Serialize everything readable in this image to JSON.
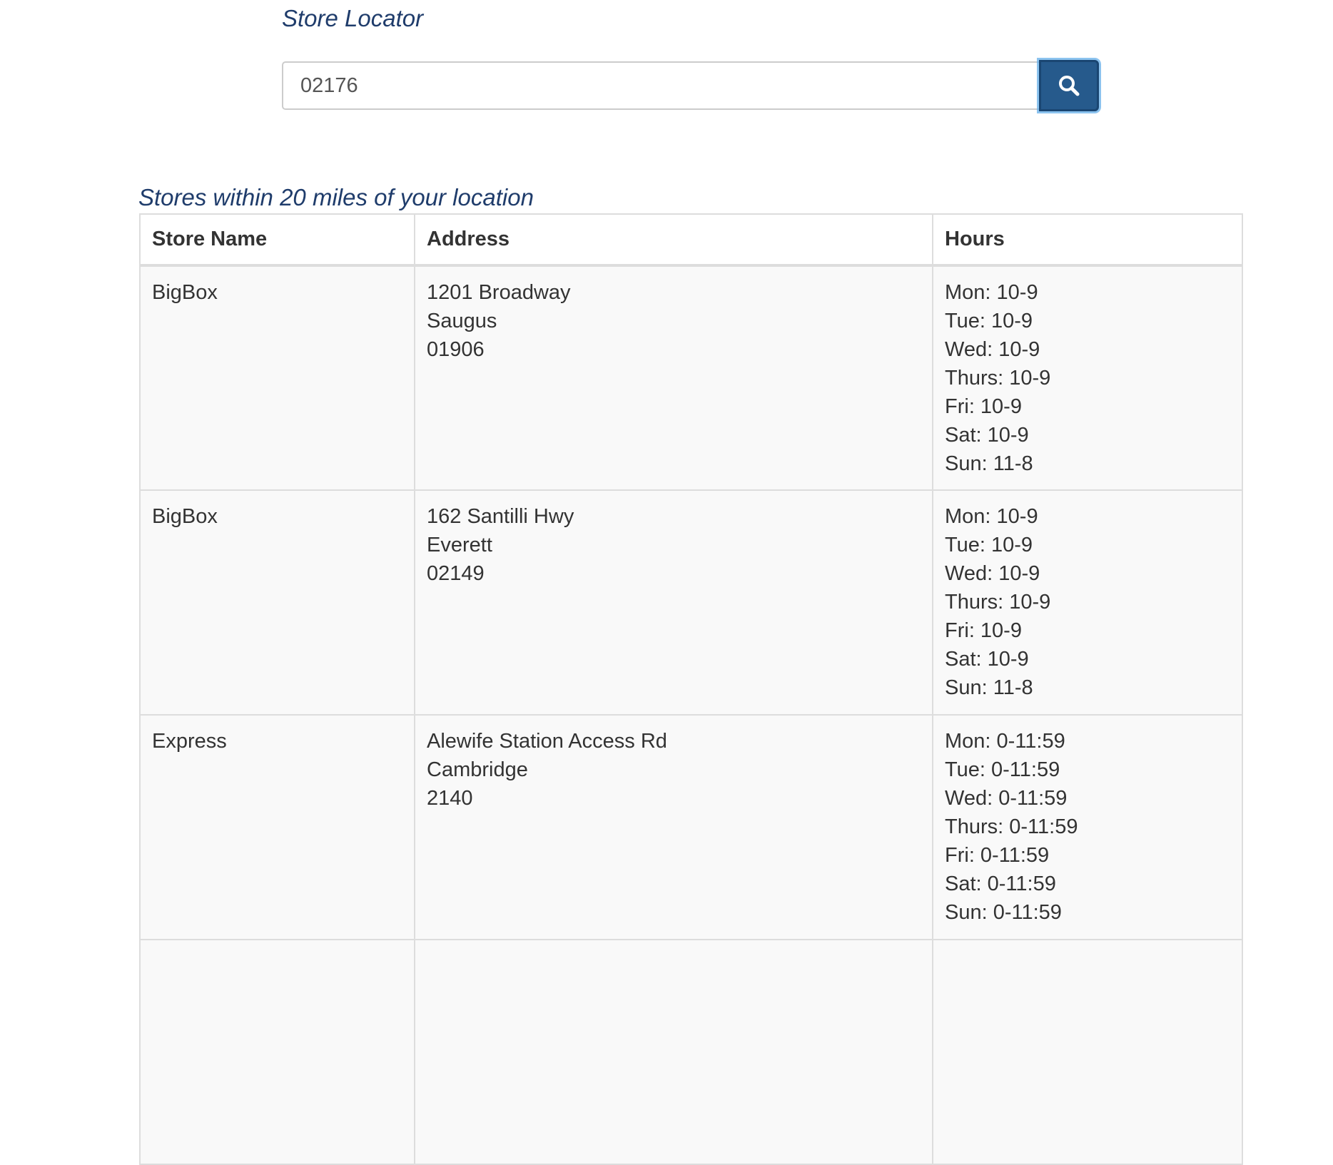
{
  "header": {
    "title": "Store Locator"
  },
  "search": {
    "value": "02176",
    "button_icon": "search-icon"
  },
  "results": {
    "title": "Stores within 20 miles of your location",
    "columns": [
      "Store Name",
      "Address",
      "Hours"
    ],
    "rows": [
      {
        "name": "BigBox",
        "address": [
          "1201 Broadway",
          "Saugus",
          "01906"
        ],
        "hours": [
          "Mon: 10-9",
          "Tue: 10-9",
          "Wed: 10-9",
          "Thurs: 10-9",
          "Fri: 10-9",
          "Sat: 10-9",
          "Sun: 11-8"
        ]
      },
      {
        "name": "BigBox",
        "address": [
          "162 Santilli Hwy",
          "Everett",
          "02149"
        ],
        "hours": [
          "Mon: 10-9",
          "Tue: 10-9",
          "Wed: 10-9",
          "Thurs: 10-9",
          "Fri: 10-9",
          "Sat: 10-9",
          "Sun: 11-8"
        ]
      },
      {
        "name": "Express",
        "address": [
          "Alewife Station Access Rd",
          "Cambridge",
          "2140"
        ],
        "hours": [
          "Mon: 0-11:59",
          "Tue: 0-11:59",
          "Wed: 0-11:59",
          "Thurs: 0-11:59",
          "Fri: 0-11:59",
          "Sat: 0-11:59",
          "Sun: 0-11:59"
        ]
      },
      {
        "name": "",
        "address": [],
        "hours": []
      }
    ]
  },
  "colors": {
    "heading": "#1f3c6b",
    "button": "#265a8c",
    "button_focus_ring": "#66afe9",
    "row_background": "#f9f9f9",
    "border": "#dddddd"
  }
}
